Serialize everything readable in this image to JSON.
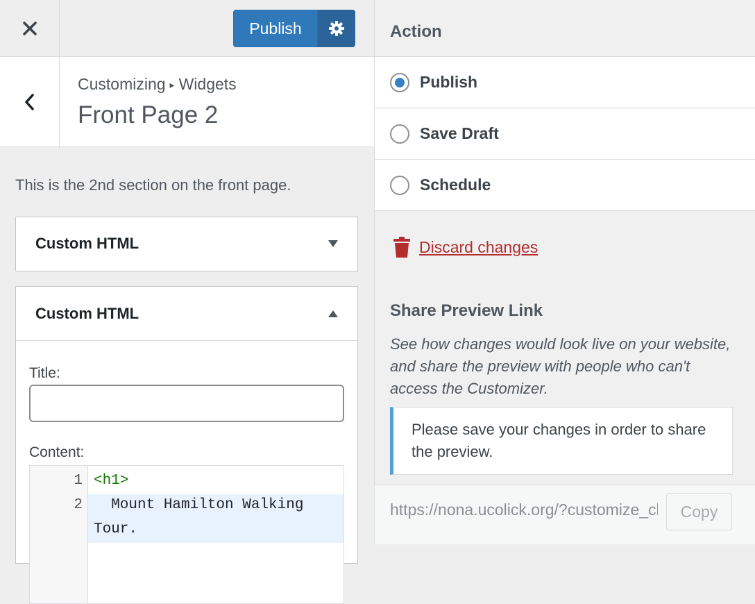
{
  "header": {
    "publish_label": "Publish"
  },
  "section": {
    "breadcrumb_root": "Customizing",
    "breadcrumb_separator": "▸",
    "breadcrumb_current": "Widgets",
    "title": "Front Page 2",
    "description": "This is the 2nd section on the front page."
  },
  "widgets": [
    {
      "title": "Custom HTML",
      "expanded": false
    },
    {
      "title": "Custom HTML",
      "expanded": true
    }
  ],
  "widget_form": {
    "title_label": "Title:",
    "title_value": "",
    "content_label": "Content:",
    "code_lines": [
      {
        "number": "1",
        "text": "<h1>"
      },
      {
        "number": "2",
        "text": "  Mount Hamilton Walking",
        "continuation": "Tour."
      }
    ]
  },
  "action": {
    "heading": "Action",
    "options": [
      {
        "label": "Publish",
        "checked": true
      },
      {
        "label": "Save Draft",
        "checked": false
      },
      {
        "label": "Schedule",
        "checked": false
      }
    ],
    "discard_label": "Discard changes"
  },
  "share": {
    "heading": "Share Preview Link",
    "description": "See how changes would look live on your website, and share the preview with people who can't access the Customizer.",
    "notice": "Please save your changes in order to share the preview.",
    "url": "https://nona.ucolick.org/?customize_changeset_uuid",
    "copy_label": "Copy"
  },
  "colors": {
    "primary": "#2f79ba",
    "primary_dark": "#2b6499",
    "danger": "#b32d2e",
    "notice_border": "#4fa3cf",
    "radio_checked": "#3582c4"
  }
}
